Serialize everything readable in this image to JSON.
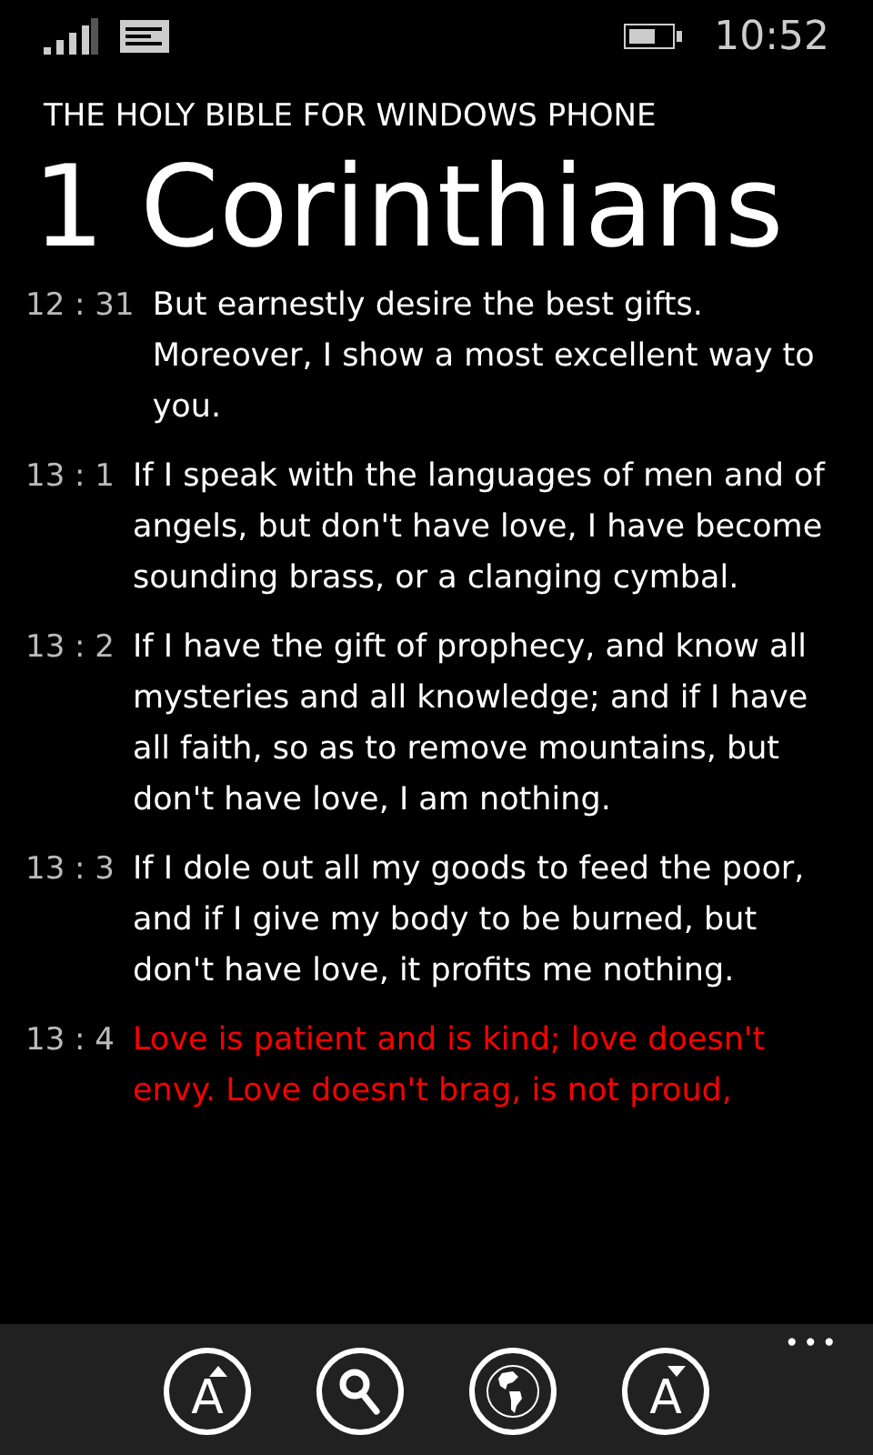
{
  "status_bar": {
    "time": "10:52"
  },
  "app_title": "THE HOLY BIBLE FOR WINDOWS PHONE",
  "book_title": "1 Corinthians",
  "verses": [
    {
      "reference": "12 : 31",
      "text": "But earnestly desire the best gifts. Moreover, I show a most excellent way to you.",
      "selected": false
    },
    {
      "reference": "13 : 1",
      "text": "If I speak with the languages of men and of angels, but don't have love, I have become sounding brass, or a clanging cymbal.",
      "selected": false
    },
    {
      "reference": "13 : 2",
      "text": "If I have the gift of prophecy, and know all mysteries and all knowledge; and if I have all faith, so as to remove mountains, but don't have love, I am nothing.",
      "selected": false
    },
    {
      "reference": "13 : 3",
      "text": "If I dole out all my goods to feed the poor, and if I give my body to be burned, but don't have love, it profits me nothing.",
      "selected": false
    },
    {
      "reference": "13 : 4",
      "text": "Love is patient and is kind; love doesn't envy. Love doesn't brag, is not proud,",
      "selected": true
    }
  ],
  "app_bar": {
    "buttons": [
      {
        "kind": "font-up",
        "label": "A"
      },
      {
        "kind": "search"
      },
      {
        "kind": "globe"
      },
      {
        "kind": "font-down",
        "label": "A"
      }
    ],
    "more": "•••"
  }
}
